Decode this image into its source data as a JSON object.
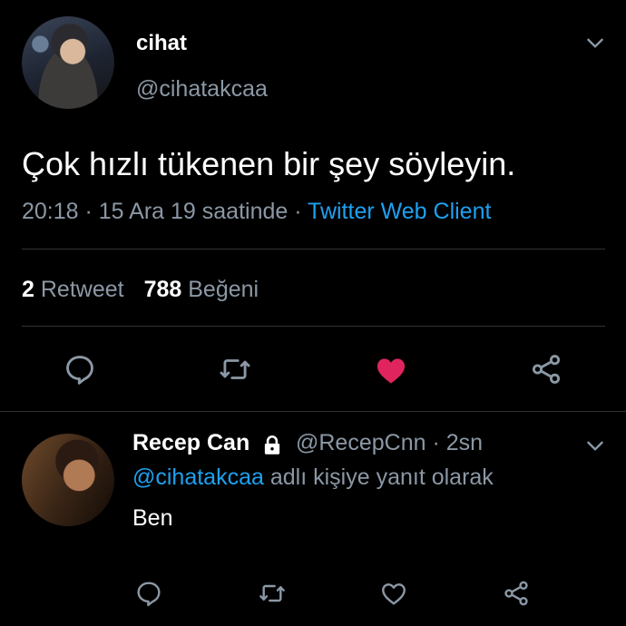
{
  "tweet": {
    "author_name": "cihat",
    "author_handle": "@cihatakcaa",
    "text": "Çok hızlı tükenen bir şey söyleyin.",
    "time_date": "20:18 · 15 Ara 19 saatinde · ",
    "client": "Twitter Web Client",
    "retweet_count": "2",
    "retweet_label": "Retweet",
    "like_count": "788",
    "like_label": "Beğeni",
    "liked": true,
    "like_color": "#e0245e"
  },
  "reply": {
    "author_name": "Recep Can",
    "author_handle": "@RecepCnn · 2sn",
    "reply_to_mention": "@cihatakcaa",
    "reply_to_suffix": " adlı kişiye yanıt olarak",
    "text": "Ben",
    "protected_icon": "lock-icon"
  },
  "colors": {
    "accent": "#1da1f2",
    "muted": "#8b98a5",
    "background": "#000000"
  }
}
